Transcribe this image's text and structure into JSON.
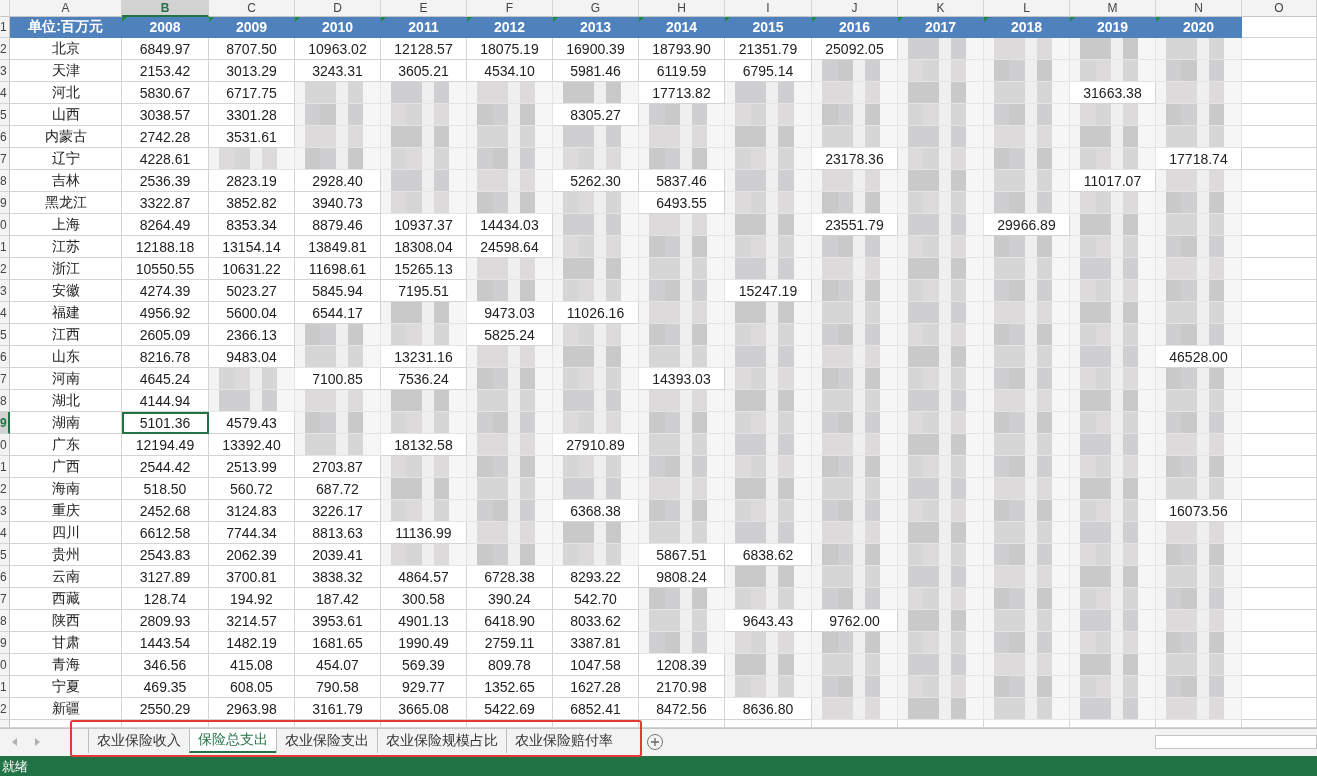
{
  "column_headers": [
    {
      "label": "A",
      "selected": false
    },
    {
      "label": "B",
      "selected": true
    },
    {
      "label": "C",
      "selected": false
    },
    {
      "label": "D",
      "selected": false
    },
    {
      "label": "E",
      "selected": false
    },
    {
      "label": "F",
      "selected": false
    },
    {
      "label": "G",
      "selected": false
    },
    {
      "label": "H",
      "selected": false
    },
    {
      "label": "I",
      "selected": false
    },
    {
      "label": "J",
      "selected": false
    },
    {
      "label": "K",
      "selected": false
    },
    {
      "label": "L",
      "selected": false
    },
    {
      "label": "M",
      "selected": false
    },
    {
      "label": "N",
      "selected": false
    },
    {
      "label": "O",
      "selected": false
    }
  ],
  "header_row": {
    "row_number": "1",
    "cells": [
      "单位:百万元",
      "2008",
      "2009",
      "2010",
      "2011",
      "2012",
      "2013",
      "2014",
      "2015",
      "2016",
      "2017",
      "2018",
      "2019",
      "2020"
    ]
  },
  "rows": [
    {
      "row_number": "2",
      "selected": false,
      "region": "北京",
      "cells": [
        "6849.97",
        "8707.50",
        "10963.02",
        "12128.57",
        "18075.19",
        "16900.39",
        "18793.90",
        "21351.79",
        "25092.05",
        null,
        null,
        null,
        null
      ]
    },
    {
      "row_number": "3",
      "selected": false,
      "region": "天津",
      "cells": [
        "2153.42",
        "3013.29",
        "3243.31",
        "3605.21",
        "4534.10",
        "5981.46",
        "6119.59",
        "6795.14",
        null,
        null,
        null,
        null,
        null
      ]
    },
    {
      "row_number": "4",
      "selected": false,
      "region": "河北",
      "cells": [
        "5830.67",
        "6717.75",
        null,
        null,
        null,
        null,
        "17713.82",
        null,
        null,
        null,
        null,
        "31663.38",
        null
      ]
    },
    {
      "row_number": "5",
      "selected": false,
      "region": "山西",
      "cells": [
        "3038.57",
        "3301.28",
        null,
        null,
        null,
        "8305.27",
        null,
        null,
        null,
        null,
        null,
        null,
        null
      ]
    },
    {
      "row_number": "6",
      "selected": false,
      "region": "内蒙古",
      "cells": [
        "2742.28",
        "3531.61",
        null,
        null,
        null,
        null,
        null,
        null,
        null,
        null,
        null,
        null,
        null
      ]
    },
    {
      "row_number": "7",
      "selected": false,
      "region": "辽宁",
      "cells": [
        "4228.61",
        null,
        null,
        null,
        null,
        null,
        null,
        null,
        "23178.36",
        null,
        null,
        null,
        "17718.74"
      ]
    },
    {
      "row_number": "8",
      "selected": false,
      "region": "吉林",
      "cells": [
        "2536.39",
        "2823.19",
        "2928.40",
        null,
        null,
        "5262.30",
        "5837.46",
        null,
        null,
        null,
        null,
        "11017.07",
        null
      ]
    },
    {
      "row_number": "9",
      "selected": false,
      "region": "黑龙江",
      "cells": [
        "3322.87",
        "3852.82",
        "3940.73",
        null,
        null,
        null,
        "6493.55",
        null,
        null,
        null,
        null,
        null,
        null
      ]
    },
    {
      "row_number": "0",
      "selected": false,
      "region": "上海",
      "cells": [
        "8264.49",
        "8353.34",
        "8879.46",
        "10937.37",
        "14434.03",
        null,
        null,
        null,
        "23551.79",
        null,
        "29966.89",
        null,
        null
      ]
    },
    {
      "row_number": "1",
      "selected": false,
      "region": "江苏",
      "cells": [
        "12188.18",
        "13154.14",
        "13849.81",
        "18308.04",
        "24598.64",
        null,
        null,
        null,
        null,
        null,
        null,
        null,
        null
      ]
    },
    {
      "row_number": "2",
      "selected": false,
      "region": "浙江",
      "cells": [
        "10550.55",
        "10631.22",
        "11698.61",
        "15265.13",
        null,
        null,
        null,
        null,
        null,
        null,
        null,
        null,
        null
      ]
    },
    {
      "row_number": "3",
      "selected": false,
      "region": "安徽",
      "cells": [
        "4274.39",
        "5023.27",
        "5845.94",
        "7195.51",
        null,
        null,
        null,
        "15247.19",
        null,
        null,
        null,
        null,
        null
      ]
    },
    {
      "row_number": "4",
      "selected": false,
      "region": "福建",
      "cells": [
        "4956.92",
        "5600.04",
        "6544.17",
        null,
        "9473.03",
        "11026.16",
        null,
        null,
        null,
        null,
        null,
        null,
        null
      ]
    },
    {
      "row_number": "5",
      "selected": false,
      "region": "江西",
      "cells": [
        "2605.09",
        "2366.13",
        null,
        null,
        "5825.24",
        null,
        null,
        null,
        null,
        null,
        null,
        null,
        null
      ]
    },
    {
      "row_number": "6",
      "selected": false,
      "region": "山东",
      "cells": [
        "8216.78",
        "9483.04",
        null,
        "13231.16",
        null,
        null,
        null,
        null,
        null,
        null,
        null,
        null,
        "46528.00"
      ]
    },
    {
      "row_number": "7",
      "selected": false,
      "region": "河南",
      "cells": [
        "4645.24",
        null,
        "7100.85",
        "7536.24",
        null,
        null,
        "14393.03",
        null,
        null,
        null,
        null,
        null,
        null
      ]
    },
    {
      "row_number": "8",
      "selected": false,
      "region": "湖北",
      "cells": [
        "4144.94",
        null,
        null,
        null,
        null,
        null,
        null,
        null,
        null,
        null,
        null,
        null,
        null
      ]
    },
    {
      "row_number": "9",
      "selected": true,
      "region": "湖南",
      "cells": [
        "5101.36",
        "4579.43",
        null,
        null,
        null,
        null,
        null,
        null,
        null,
        null,
        null,
        null,
        null
      ]
    },
    {
      "row_number": "0",
      "selected": false,
      "region": "广东",
      "cells": [
        "12194.49",
        "13392.40",
        null,
        "18132.58",
        null,
        "27910.89",
        null,
        null,
        null,
        null,
        null,
        null,
        null
      ]
    },
    {
      "row_number": "1",
      "selected": false,
      "region": "广西",
      "cells": [
        "2544.42",
        "2513.99",
        "2703.87",
        null,
        null,
        null,
        null,
        null,
        null,
        null,
        null,
        null,
        null
      ]
    },
    {
      "row_number": "2",
      "selected": false,
      "region": "海南",
      "cells": [
        "518.50",
        "560.72",
        "687.72",
        null,
        null,
        null,
        null,
        null,
        null,
        null,
        null,
        null,
        null
      ]
    },
    {
      "row_number": "3",
      "selected": false,
      "region": "重庆",
      "cells": [
        "2452.68",
        "3124.83",
        "3226.17",
        null,
        null,
        "6368.38",
        null,
        null,
        null,
        null,
        null,
        null,
        "16073.56"
      ]
    },
    {
      "row_number": "4",
      "selected": false,
      "region": "四川",
      "cells": [
        "6612.58",
        "7744.34",
        "8813.63",
        "11136.99",
        null,
        null,
        null,
        null,
        null,
        null,
        null,
        null,
        null
      ]
    },
    {
      "row_number": "5",
      "selected": false,
      "region": "贵州",
      "cells": [
        "2543.83",
        "2062.39",
        "2039.41",
        null,
        null,
        null,
        "5867.51",
        "6838.62",
        null,
        null,
        null,
        null,
        null
      ]
    },
    {
      "row_number": "6",
      "selected": false,
      "region": "云南",
      "cells": [
        "3127.89",
        "3700.81",
        "3838.32",
        "4864.57",
        "6728.38",
        "8293.22",
        "9808.24",
        null,
        null,
        null,
        null,
        null,
        null
      ]
    },
    {
      "row_number": "7",
      "selected": false,
      "region": "西藏",
      "cells": [
        "128.74",
        "194.92",
        "187.42",
        "300.58",
        "390.24",
        "542.70",
        null,
        null,
        null,
        null,
        null,
        null,
        null
      ]
    },
    {
      "row_number": "8",
      "selected": false,
      "region": "陕西",
      "cells": [
        "2809.93",
        "3214.57",
        "3953.61",
        "4901.13",
        "6418.90",
        "8033.62",
        null,
        "9643.43",
        "9762.00",
        null,
        null,
        null,
        null
      ]
    },
    {
      "row_number": "9",
      "selected": false,
      "region": "甘肃",
      "cells": [
        "1443.54",
        "1482.19",
        "1681.65",
        "1990.49",
        "2759.11",
        "3387.81",
        null,
        null,
        null,
        null,
        null,
        null,
        null
      ]
    },
    {
      "row_number": "0",
      "selected": false,
      "region": "青海",
      "cells": [
        "346.56",
        "415.08",
        "454.07",
        "569.39",
        "809.78",
        "1047.58",
        "1208.39",
        null,
        null,
        null,
        null,
        null,
        null
      ]
    },
    {
      "row_number": "1",
      "selected": false,
      "region": "宁夏",
      "cells": [
        "469.35",
        "608.05",
        "790.58",
        "929.77",
        "1352.65",
        "1627.28",
        "2170.98",
        null,
        null,
        null,
        null,
        null,
        null
      ]
    },
    {
      "row_number": "2",
      "selected": false,
      "region": "新疆",
      "cells": [
        "2550.29",
        "2963.98",
        "3161.79",
        "3665.08",
        "5422.69",
        "6852.41",
        "8472.56",
        "8636.80",
        null,
        null,
        null,
        null,
        null
      ]
    }
  ],
  "sheet_tabs": [
    {
      "label": "农业保险收入",
      "selected": false
    },
    {
      "label": "保险总支出",
      "selected": true
    },
    {
      "label": "农业保险支出",
      "selected": false
    },
    {
      "label": "农业保险规模占比",
      "selected": false
    },
    {
      "label": "农业保险赔付率",
      "selected": false
    }
  ],
  "status_bar": {
    "text": "就绪"
  }
}
